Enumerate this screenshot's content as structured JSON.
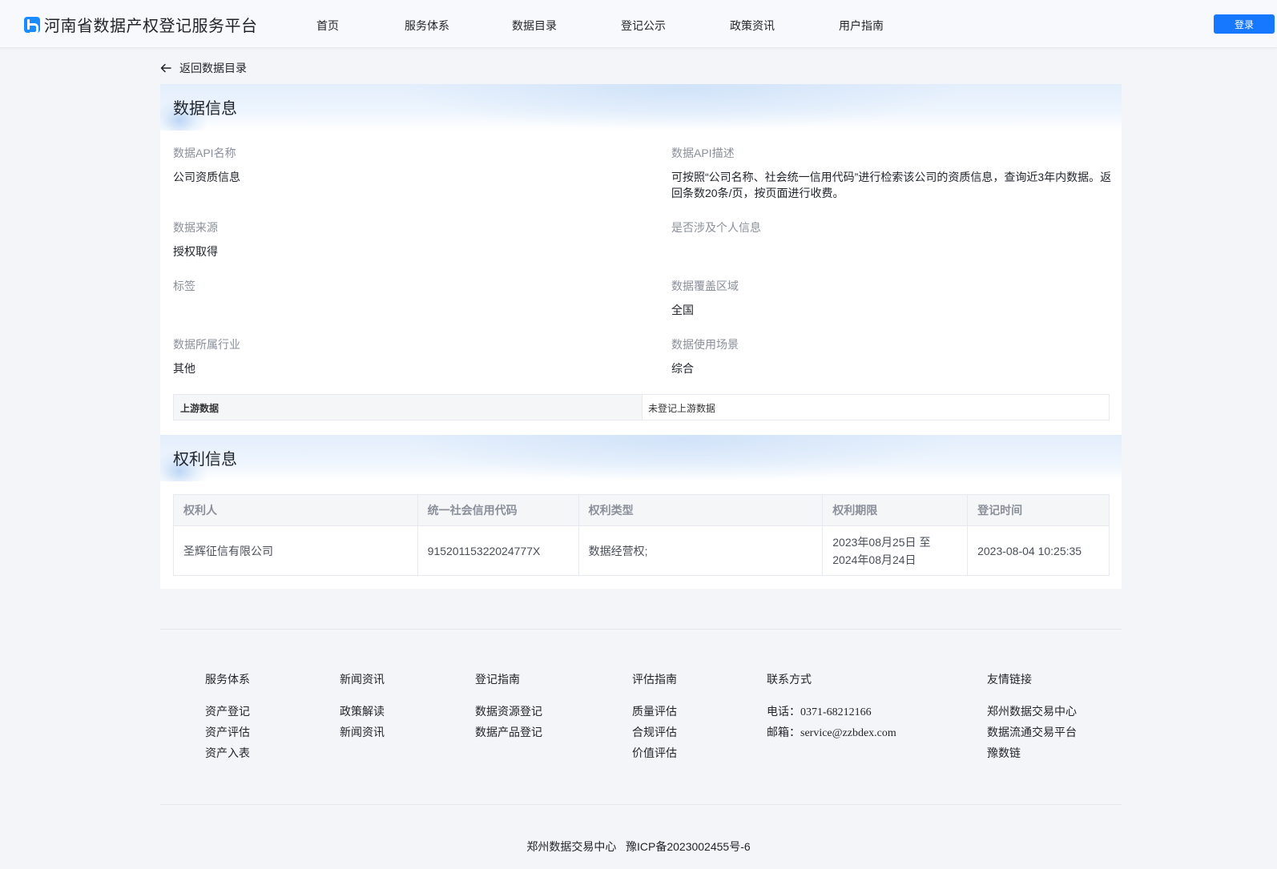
{
  "header": {
    "title": "河南省数据产权登记服务平台",
    "nav": [
      "首页",
      "服务体系",
      "数据目录",
      "登记公示",
      "政策资讯",
      "用户指南"
    ],
    "login_label": "登录"
  },
  "back": {
    "label": "返回数据目录"
  },
  "data_info": {
    "title": "数据信息",
    "fields": {
      "api_name": {
        "label": "数据API名称",
        "value": "公司资质信息"
      },
      "api_desc": {
        "label": "数据API描述",
        "value": "可按照“公司名称、社会统一信用代码”进行检索该公司的资质信息，查询近3年内数据。返回条数20条/页，按页面进行收费。"
      },
      "source": {
        "label": "数据来源",
        "value": "授权取得"
      },
      "personal": {
        "label": "是否涉及个人信息",
        "value": ""
      },
      "tags": {
        "label": "标签",
        "value": ""
      },
      "coverage": {
        "label": "数据覆盖区域",
        "value": "全国"
      },
      "industry": {
        "label": "数据所属行业",
        "value": "其他"
      },
      "scenario": {
        "label": "数据使用场景",
        "value": "综合"
      }
    },
    "upstream": {
      "label": "上游数据",
      "value": "未登记上游数据"
    }
  },
  "rights_info": {
    "title": "权利信息",
    "columns": [
      "权利人",
      "统一社会信用代码",
      "权利类型",
      "权利期限",
      "登记时间"
    ],
    "rows": [
      {
        "holder": "圣辉征信有限公司",
        "credit_code": "91520115322024777X",
        "type": "数据经营权;",
        "term_start": "2023年08月25日 至",
        "term_end": "2024年08月24日",
        "registered_at": "2023-08-04 10:25:35"
      }
    ]
  },
  "footer": {
    "columns": [
      {
        "title": "服务体系",
        "items": [
          "资产登记",
          "资产评估",
          "资产入表"
        ]
      },
      {
        "title": "新闻资讯",
        "items": [
          "政策解读",
          "新闻资讯"
        ]
      },
      {
        "title": "登记指南",
        "items": [
          "数据资源登记",
          "数据产品登记"
        ]
      },
      {
        "title": "评估指南",
        "items": [
          "质量评估",
          "合规评估",
          "价值评估"
        ]
      }
    ],
    "contact": {
      "title": "联系方式",
      "phone_label": "电话：",
      "phone": "0371-68212166",
      "email_label": "邮箱：",
      "email": "service@zzbdex.com"
    },
    "links": {
      "title": "友情链接",
      "items": [
        "郑州数据交易中心",
        "数据流通交易平台",
        "豫数链"
      ]
    },
    "org": "郑州数据交易中心",
    "icp": "豫ICP备2023002455号-6"
  }
}
